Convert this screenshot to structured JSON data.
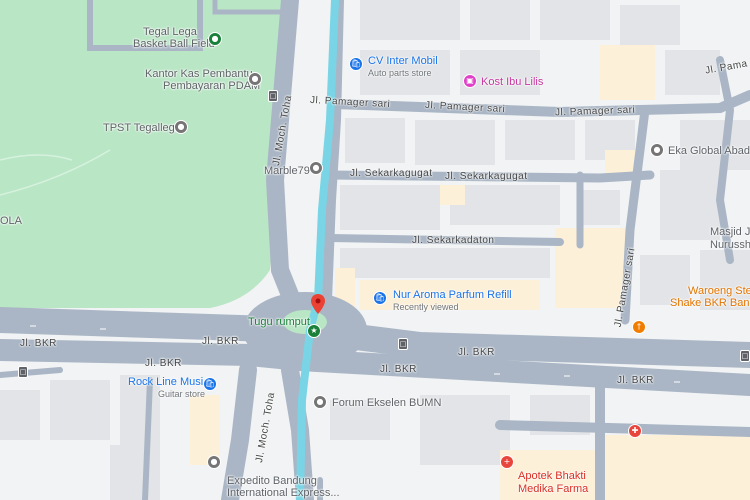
{
  "colors": {
    "park": "#b9e6c5",
    "road": "#aab6c5",
    "river": "#79d5e5",
    "building": "#e2e4e7",
    "poi_generic": "#757575",
    "poi_shop": "#1a73e8",
    "poi_lodging": "#e040c8",
    "poi_food": "#f07c00",
    "poi_health": "#e8453c",
    "poi_park": "#188038",
    "poi_transit": "#5f6368",
    "marker": "#ea4335"
  },
  "pois": {
    "tegal_lega": {
      "line1": "Tegal Lega",
      "line2": "Basket Ball Field",
      "icon": "park-icon"
    },
    "kantor_kas": {
      "line1": "Kantor Kas Pembantu",
      "line2": "Pembayaran PDAM",
      "icon": "place-icon"
    },
    "tpst": {
      "name": "TPST Tegallega",
      "icon": "place-icon"
    },
    "marble": {
      "name": "Marble79",
      "icon": "place-icon"
    },
    "cv_inter": {
      "name": "CV Inter Mobil",
      "sub": "Auto parts store",
      "icon": "shopping-bag-icon"
    },
    "kost": {
      "name": "Kost Ibu Lilis",
      "icon": "bed-icon"
    },
    "eka": {
      "name": "Eka Global Abadi",
      "icon": "place-icon"
    },
    "masjid": {
      "line1": "Masjid J",
      "line2": "Nurussh"
    },
    "nur_aroma": {
      "name": "Nur Aroma Parfum Refill",
      "sub": "Recently viewed",
      "icon": "shopping-bag-icon"
    },
    "waroeng": {
      "line1": "Waroeng Steak",
      "line2": "Shake BKR Bandung",
      "icon": "restaurant-icon"
    },
    "tugu": {
      "name": "Tugu rumput",
      "icon": "monument-icon"
    },
    "rock_line": {
      "name": "Rock Line Music",
      "sub": "Guitar store",
      "icon": "shopping-bag-icon"
    },
    "forum": {
      "name": "Forum Ekselen BUMN",
      "icon": "place-icon"
    },
    "expedito": {
      "line1": "Expedito Bandung",
      "line2": "International Express...",
      "icon": "place-icon"
    },
    "apotek": {
      "line1": "Apotek Bhakti",
      "line2": "Medika Farma",
      "icon": "pharmacy-icon"
    },
    "ola": {
      "name": "OLA"
    }
  },
  "roads": {
    "bkr": "Jl. BKR",
    "moch_toha": "Jl. Moch. Toha",
    "pamager_sari": "Jl. Pamager sari",
    "pamager_sari_short": "Jl. Pama",
    "sekarkagugat": "Jl. Sekarkagugat",
    "sekarkadaton": "Jl. Sekarkadaton"
  }
}
